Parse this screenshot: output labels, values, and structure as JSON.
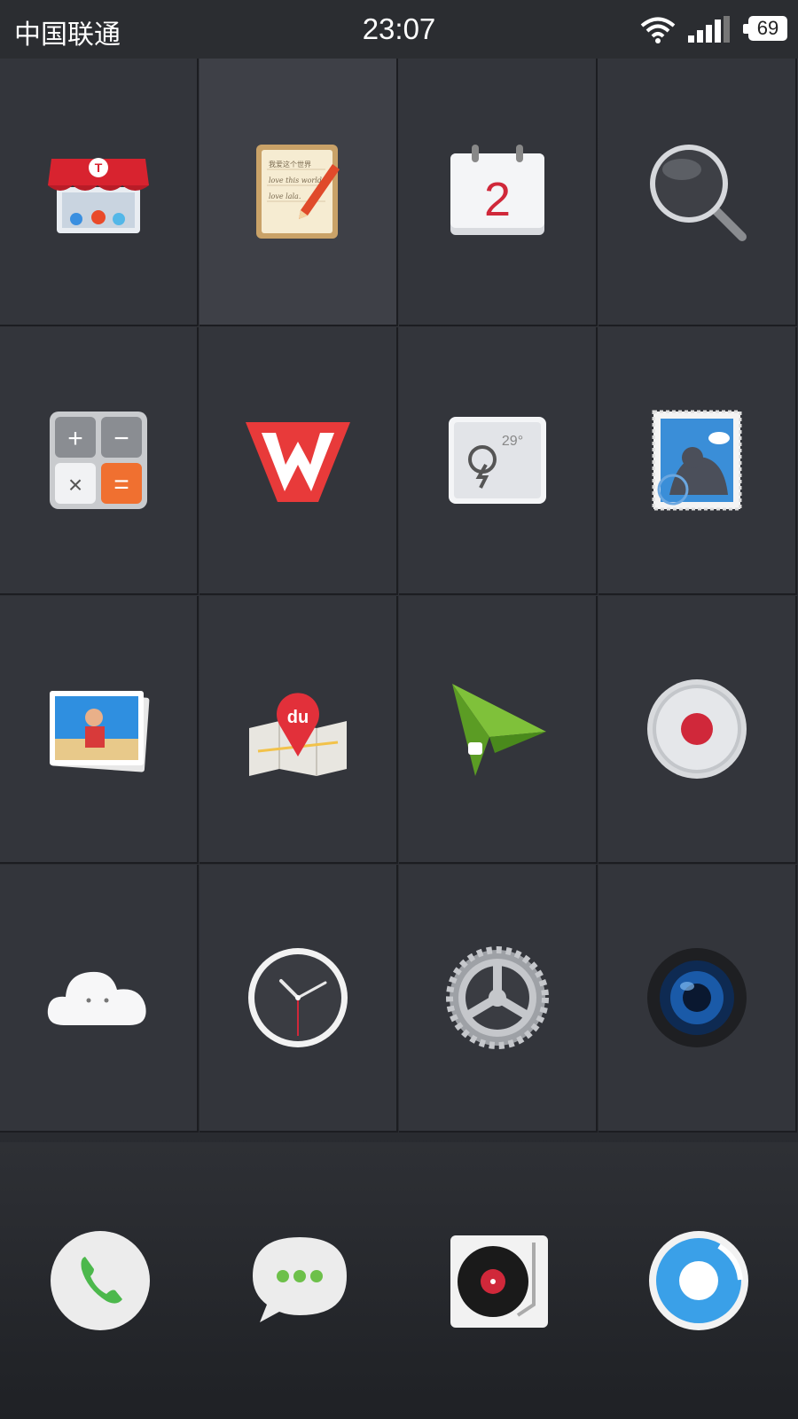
{
  "status_bar": {
    "carrier": "中国联通",
    "time": "23:07",
    "battery": "69"
  },
  "apps": {
    "calendar_day": "2",
    "weather_temp": "29°",
    "wps_letter": "W",
    "map_badge": "du",
    "notes_lines": [
      "我爱这个世界",
      "love this world.",
      "love lala."
    ]
  },
  "grid_icons": [
    "store-icon",
    "notes-icon",
    "calendar-icon",
    "search-icon",
    "calculator-icon",
    "wps-office-icon",
    "weather-icon",
    "mail-icon",
    "gallery-icon",
    "baidu-map-icon",
    "paper-plane-icon",
    "recorder-icon",
    "cloud-icon",
    "clock-icon",
    "settings-gear-icon",
    "camera-icon"
  ],
  "dock_icons": [
    "phone-icon",
    "messages-icon",
    "music-player-icon",
    "browser-icon"
  ],
  "colors": {
    "background": "#33353b",
    "highlight_cell": "#3e4047",
    "accent_red": "#d0283a",
    "phone_green": "#4cb84c",
    "browser_blue": "#3aa0e8",
    "calculator_orange": "#f07030"
  }
}
